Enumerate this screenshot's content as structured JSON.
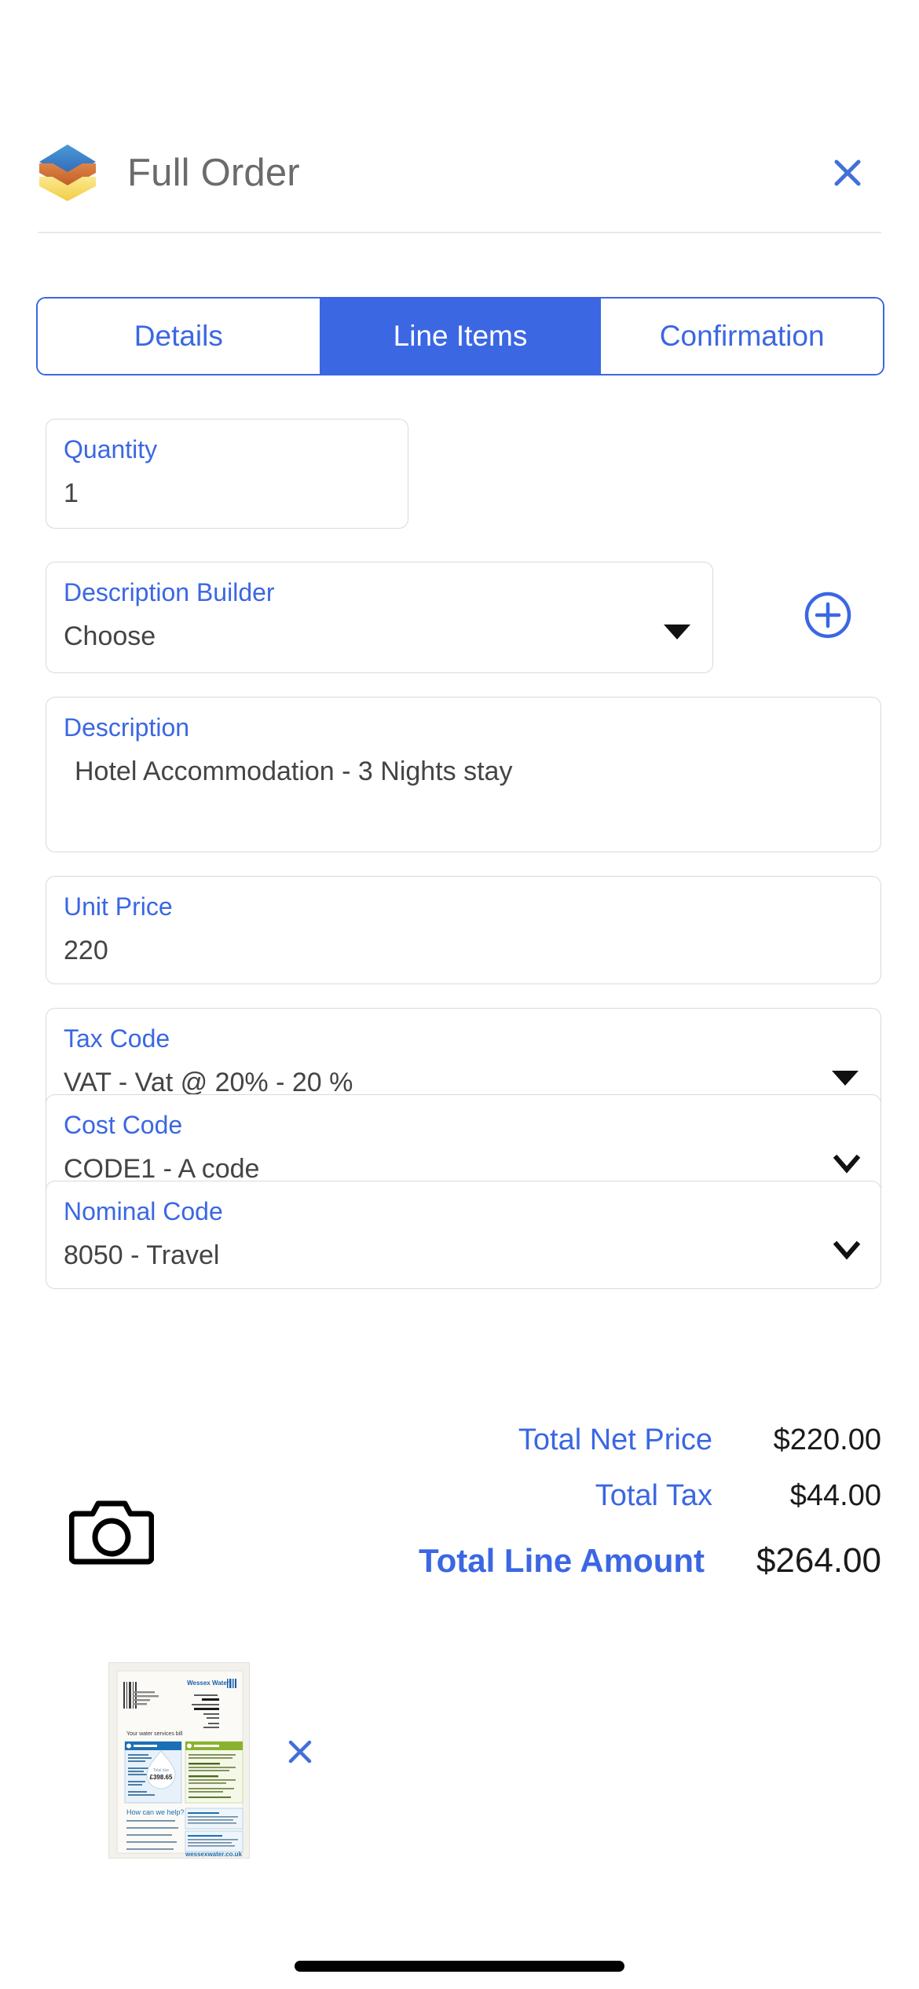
{
  "header": {
    "title": "Full Order",
    "logo_icon": "stacked-layers-icon",
    "close_icon": "close-icon",
    "logo_colors": [
      "#3a86d4",
      "#c96a2e",
      "#f2d24f"
    ],
    "title_color": "#6b6b6b"
  },
  "theme": {
    "accent_blue": "#3b67e3",
    "label_blue": "#3b67e3",
    "border_grey": "#dadadf",
    "value_grey": "#444444"
  },
  "tabs": [
    {
      "label": "Details",
      "active": false
    },
    {
      "label": "Line Items",
      "active": true
    },
    {
      "label": "Confirmation",
      "active": false
    }
  ],
  "form": {
    "quantity": {
      "label": "Quantity",
      "value": "1"
    },
    "description_builder": {
      "label": "Description Builder",
      "value": "Choose",
      "caret_icon": "triangle-down-icon"
    },
    "add_button": {
      "icon": "plus-circle-icon"
    },
    "description": {
      "label": "Description",
      "value": "Hotel Accommodation - 3 Nights stay"
    },
    "unit_price": {
      "label": "Unit Price",
      "value": "220"
    },
    "tax_code": {
      "label": "Tax Code",
      "value": "VAT - Vat @ 20% - 20 %",
      "caret_icon": "triangle-down-icon"
    },
    "cost_code": {
      "label": "Cost Code",
      "value": "CODE1 - A code",
      "caret_icon": "chevron-down-icon"
    },
    "nominal_code": {
      "label": "Nominal Code",
      "value": "8050 - Travel",
      "caret_icon": "chevron-down-icon"
    }
  },
  "totals": {
    "net": {
      "label": "Total Net Price",
      "amount": "$220.00"
    },
    "tax": {
      "label": "Total Tax",
      "amount": "$44.00"
    },
    "line": {
      "label": "Total Line Amount",
      "amount": "$264.00"
    }
  },
  "attachments": {
    "camera_icon": "camera-icon",
    "items": [
      {
        "icon": "document-thumbnail",
        "remove_icon": "close-icon"
      }
    ]
  }
}
